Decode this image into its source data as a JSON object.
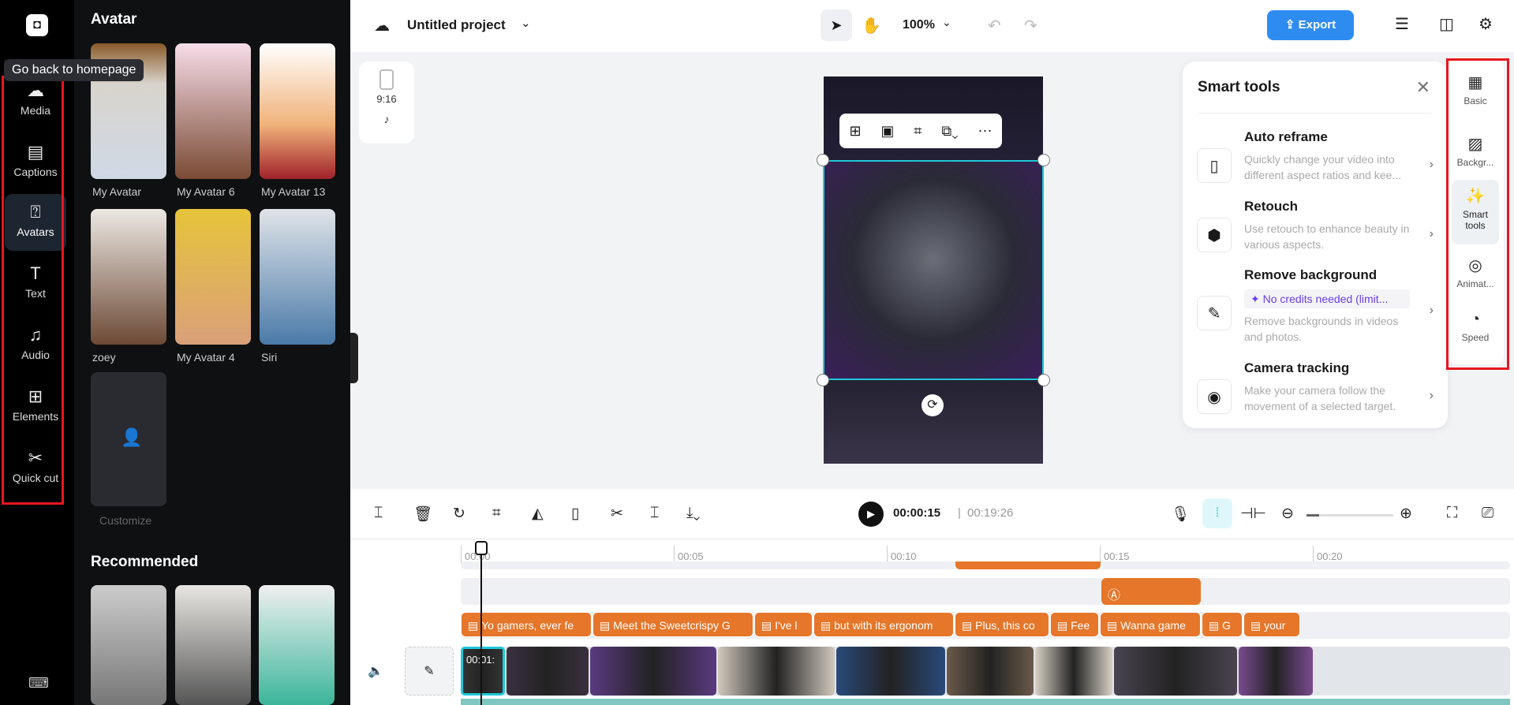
{
  "rail": {
    "items": [
      {
        "label": "Media",
        "icon": "cloud-upload-icon"
      },
      {
        "label": "Captions",
        "icon": "captions-icon"
      },
      {
        "label": "Avatars",
        "icon": "avatar-icon",
        "active": true
      },
      {
        "label": "Text",
        "icon": "text-icon"
      },
      {
        "label": "Audio",
        "icon": "music-icon"
      },
      {
        "label": "Elements",
        "icon": "elements-icon"
      },
      {
        "label": "Quick cut",
        "icon": "quick-cut-icon"
      }
    ],
    "tooltip": "Go back to homepage"
  },
  "assets": {
    "title": "Avatar",
    "avatars": [
      {
        "name": "My Avatar"
      },
      {
        "name": "My Avatar 6"
      },
      {
        "name": "My Avatar 13"
      },
      {
        "name": "zoey"
      },
      {
        "name": "My Avatar 4"
      },
      {
        "name": "Siri"
      }
    ],
    "customize": "Customize",
    "recommended": "Recommended"
  },
  "topbar": {
    "project": "Untitled project",
    "zoom": "100%",
    "export": "Export"
  },
  "canvas": {
    "ratio": "9:16"
  },
  "smart_tools": {
    "title": "Smart tools",
    "items": [
      {
        "title": "Auto reframe",
        "desc": "Quickly change your video into different aspect ratios and kee..."
      },
      {
        "title": "Retouch",
        "desc": "Use retouch to enhance beauty in various aspects."
      },
      {
        "title": "Remove background",
        "badge": "✦ No credits needed (limit...",
        "desc": "Remove backgrounds in videos and photos."
      },
      {
        "title": "Camera tracking",
        "desc": "Make your camera follow the movement of a selected target."
      }
    ]
  },
  "props": {
    "items": [
      {
        "label": "Basic"
      },
      {
        "label": "Backgr..."
      },
      {
        "label": "Smart tools",
        "active": true
      },
      {
        "label": "Animat..."
      },
      {
        "label": "Speed"
      }
    ]
  },
  "player": {
    "current": "00:00:15",
    "total": "00:19:26"
  },
  "timeline": {
    "ticks": [
      "00:00",
      "00:05",
      "00:10",
      "00:15",
      "00:20"
    ],
    "captions": [
      "Yo gamers, ever fe",
      "Meet the Sweetcrispy G",
      "I've l",
      "but with its ergonom",
      "Plus, this co",
      "Fee",
      "Wanna game",
      "G",
      "your"
    ],
    "first_clip_label": "00:01:"
  },
  "colors": {
    "accent": "#2e8cf0",
    "caption": "#e5762a",
    "selection": "#1ec8d8"
  }
}
